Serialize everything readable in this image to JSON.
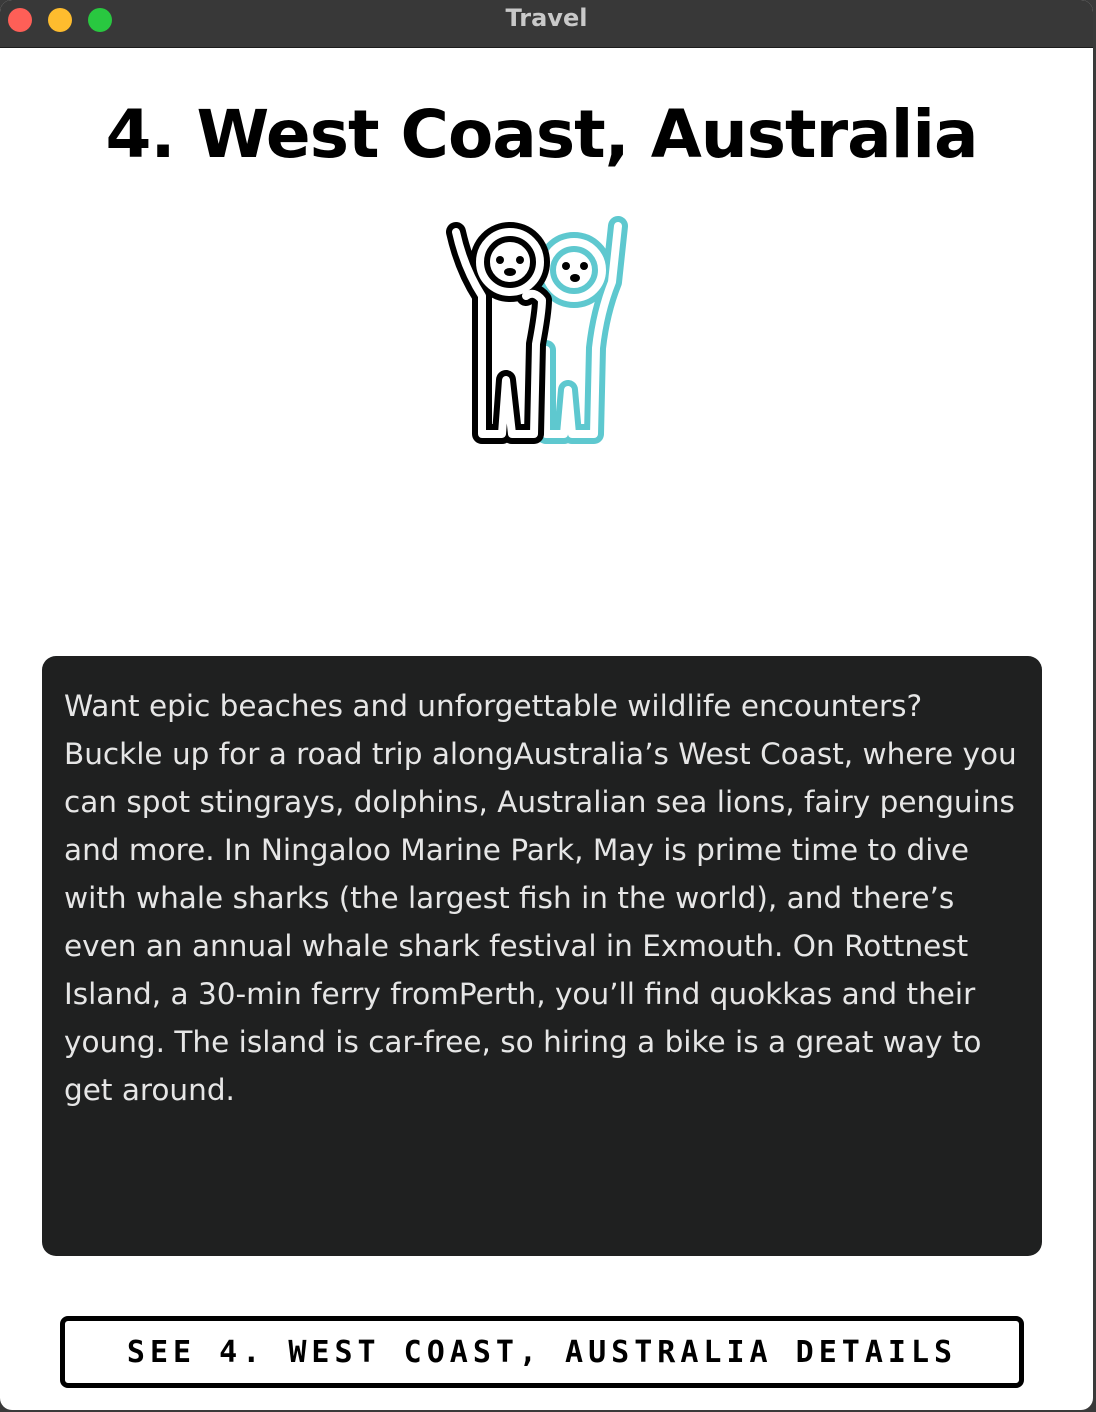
{
  "window": {
    "title": "Travel"
  },
  "page": {
    "title": "4. West Coast, Australia",
    "illustration_icon": "two-people-waving-icon",
    "description": "Want epic beaches and unforgettable wildlife encounters? Buckle up for a road trip alongAustralia’s West Coast, where you can spot stingrays, dolphins, Australian sea lions, fairy penguins and more. In Ningaloo Marine Park, May is prime time to dive with whale sharks (the largest fish in the world), and there’s even an annual whale shark festival in Exmouth. On Rottnest Island, a 30-min ferry fromPerth, you’ll find quokkas and their young. The island is car-free, so hiring a bike is a great way to get around.",
    "details_button_label": "SEE 4. WEST COAST, AUSTRALIA DETAILS"
  },
  "colors": {
    "titlebar": "#383838",
    "card_background": "#1f2020",
    "card_text": "#e6e6e6",
    "accent_teal": "#5ec8cf",
    "traffic_close": "#fe5f57",
    "traffic_minimize": "#febc2e",
    "traffic_zoom": "#29c840"
  }
}
